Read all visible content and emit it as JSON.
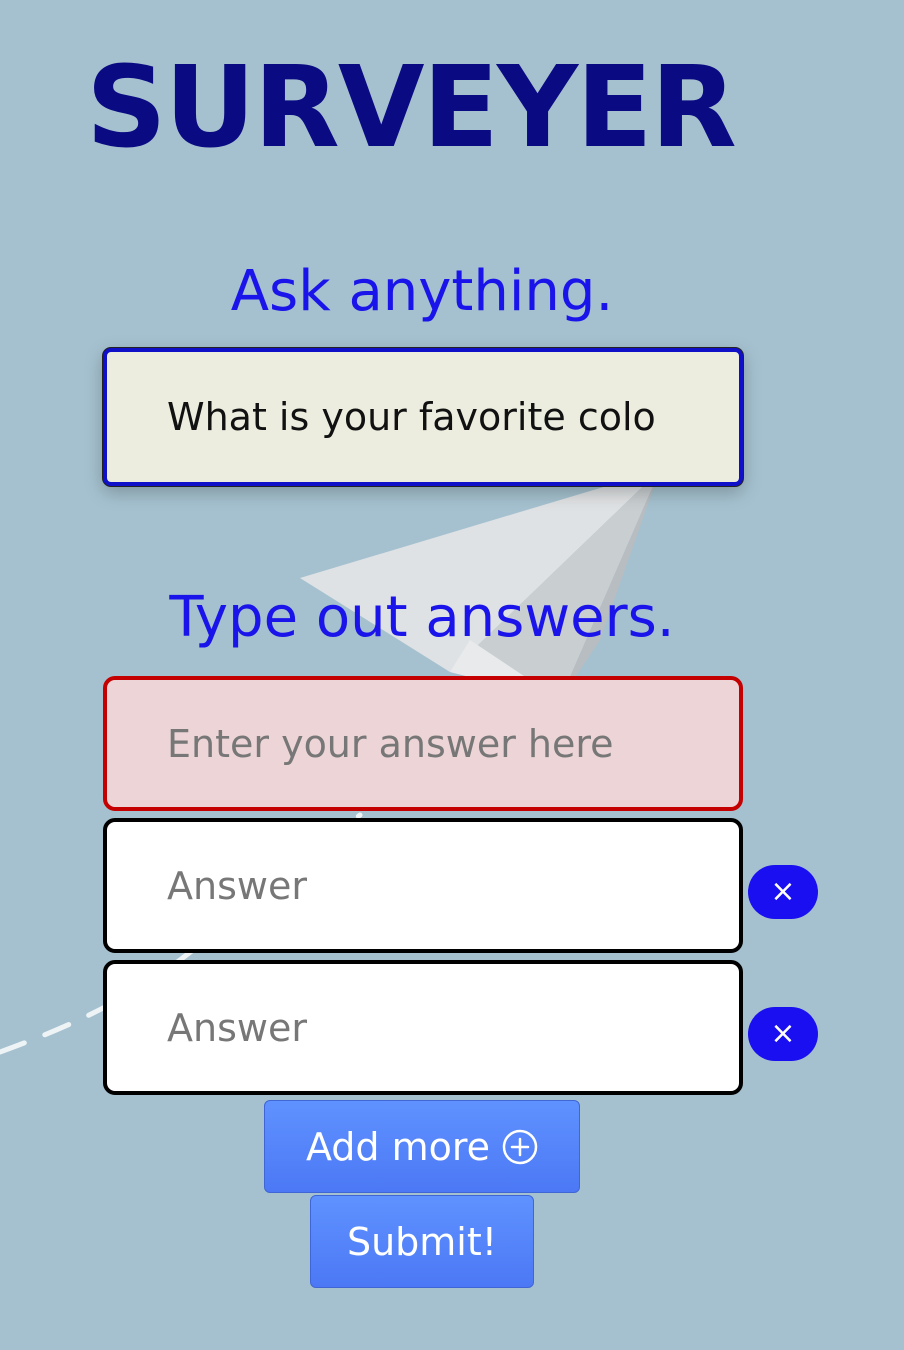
{
  "app": {
    "title": "SURVEYER"
  },
  "question_section": {
    "heading": "Ask anything.",
    "question_value": "What is your favorite colo"
  },
  "answers_section": {
    "heading": "Type out answers.",
    "answers": [
      {
        "placeholder": "Enter your answer here",
        "value": ""
      },
      {
        "placeholder": "Answer",
        "value": "",
        "remove_label": "×"
      },
      {
        "placeholder": "Answer",
        "value": "",
        "remove_label": "×"
      }
    ]
  },
  "actions": {
    "add_more_label": "Add more",
    "submit_label": "Submit!"
  },
  "colors": {
    "background": "#a5c1cf",
    "title": "#0a0a82",
    "heading": "#1a14ea",
    "button": "#5080f8",
    "remove_button": "#1a0ff0",
    "error_border": "#c40000"
  },
  "icons": {
    "add_more": "plus-circle-icon",
    "remove": "close-icon",
    "background_art": "paper-plane-icon"
  }
}
